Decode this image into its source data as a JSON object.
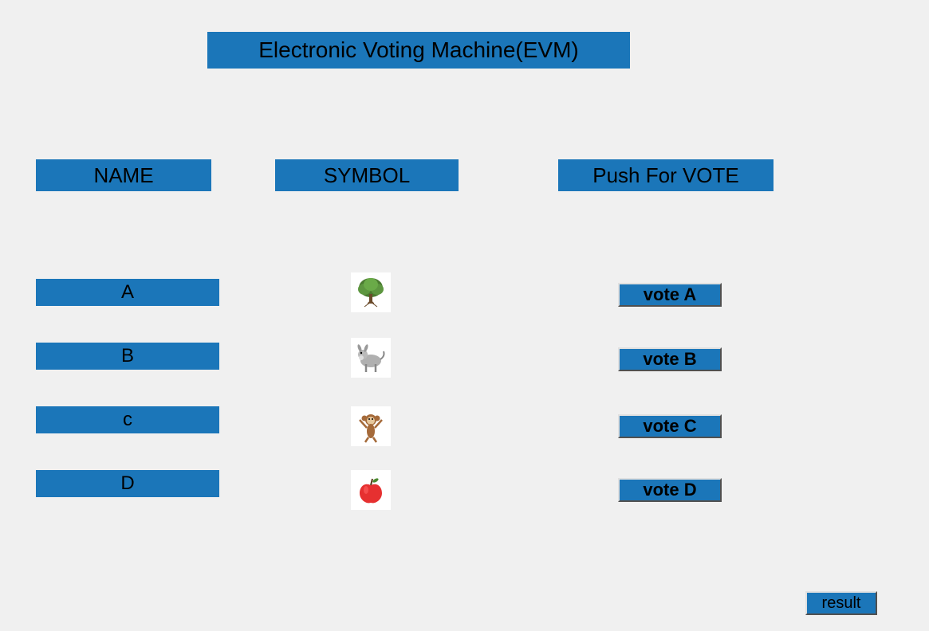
{
  "title": "Electronic Voting Machine(EVM)",
  "headers": {
    "name": "NAME",
    "symbol": "SYMBOL",
    "vote": "Push For VOTE"
  },
  "candidates": [
    {
      "name": "A",
      "symbol": "tree-icon",
      "vote_label": "vote A"
    },
    {
      "name": "B",
      "symbol": "donkey-icon",
      "vote_label": "vote B"
    },
    {
      "name": "c",
      "symbol": "monkey-icon",
      "vote_label": "vote C"
    },
    {
      "name": "D",
      "symbol": "apple-icon",
      "vote_label": "vote D"
    }
  ],
  "result_label": "result"
}
